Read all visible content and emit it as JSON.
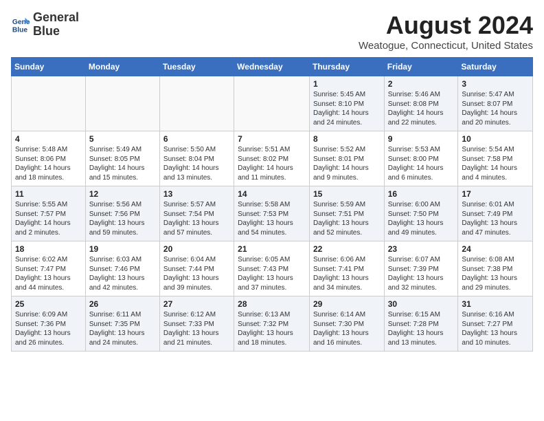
{
  "header": {
    "logo_line1": "General",
    "logo_line2": "Blue",
    "month_year": "August 2024",
    "location": "Weatogue, Connecticut, United States"
  },
  "days_of_week": [
    "Sunday",
    "Monday",
    "Tuesday",
    "Wednesday",
    "Thursday",
    "Friday",
    "Saturday"
  ],
  "weeks": [
    [
      {
        "day": "",
        "sunrise": "",
        "sunset": "",
        "daylight": ""
      },
      {
        "day": "",
        "sunrise": "",
        "sunset": "",
        "daylight": ""
      },
      {
        "day": "",
        "sunrise": "",
        "sunset": "",
        "daylight": ""
      },
      {
        "day": "",
        "sunrise": "",
        "sunset": "",
        "daylight": ""
      },
      {
        "day": "1",
        "sunrise": "Sunrise: 5:45 AM",
        "sunset": "Sunset: 8:10 PM",
        "daylight": "Daylight: 14 hours and 24 minutes."
      },
      {
        "day": "2",
        "sunrise": "Sunrise: 5:46 AM",
        "sunset": "Sunset: 8:08 PM",
        "daylight": "Daylight: 14 hours and 22 minutes."
      },
      {
        "day": "3",
        "sunrise": "Sunrise: 5:47 AM",
        "sunset": "Sunset: 8:07 PM",
        "daylight": "Daylight: 14 hours and 20 minutes."
      }
    ],
    [
      {
        "day": "4",
        "sunrise": "Sunrise: 5:48 AM",
        "sunset": "Sunset: 8:06 PM",
        "daylight": "Daylight: 14 hours and 18 minutes."
      },
      {
        "day": "5",
        "sunrise": "Sunrise: 5:49 AM",
        "sunset": "Sunset: 8:05 PM",
        "daylight": "Daylight: 14 hours and 15 minutes."
      },
      {
        "day": "6",
        "sunrise": "Sunrise: 5:50 AM",
        "sunset": "Sunset: 8:04 PM",
        "daylight": "Daylight: 14 hours and 13 minutes."
      },
      {
        "day": "7",
        "sunrise": "Sunrise: 5:51 AM",
        "sunset": "Sunset: 8:02 PM",
        "daylight": "Daylight: 14 hours and 11 minutes."
      },
      {
        "day": "8",
        "sunrise": "Sunrise: 5:52 AM",
        "sunset": "Sunset: 8:01 PM",
        "daylight": "Daylight: 14 hours and 9 minutes."
      },
      {
        "day": "9",
        "sunrise": "Sunrise: 5:53 AM",
        "sunset": "Sunset: 8:00 PM",
        "daylight": "Daylight: 14 hours and 6 minutes."
      },
      {
        "day": "10",
        "sunrise": "Sunrise: 5:54 AM",
        "sunset": "Sunset: 7:58 PM",
        "daylight": "Daylight: 14 hours and 4 minutes."
      }
    ],
    [
      {
        "day": "11",
        "sunrise": "Sunrise: 5:55 AM",
        "sunset": "Sunset: 7:57 PM",
        "daylight": "Daylight: 14 hours and 2 minutes."
      },
      {
        "day": "12",
        "sunrise": "Sunrise: 5:56 AM",
        "sunset": "Sunset: 7:56 PM",
        "daylight": "Daylight: 13 hours and 59 minutes."
      },
      {
        "day": "13",
        "sunrise": "Sunrise: 5:57 AM",
        "sunset": "Sunset: 7:54 PM",
        "daylight": "Daylight: 13 hours and 57 minutes."
      },
      {
        "day": "14",
        "sunrise": "Sunrise: 5:58 AM",
        "sunset": "Sunset: 7:53 PM",
        "daylight": "Daylight: 13 hours and 54 minutes."
      },
      {
        "day": "15",
        "sunrise": "Sunrise: 5:59 AM",
        "sunset": "Sunset: 7:51 PM",
        "daylight": "Daylight: 13 hours and 52 minutes."
      },
      {
        "day": "16",
        "sunrise": "Sunrise: 6:00 AM",
        "sunset": "Sunset: 7:50 PM",
        "daylight": "Daylight: 13 hours and 49 minutes."
      },
      {
        "day": "17",
        "sunrise": "Sunrise: 6:01 AM",
        "sunset": "Sunset: 7:49 PM",
        "daylight": "Daylight: 13 hours and 47 minutes."
      }
    ],
    [
      {
        "day": "18",
        "sunrise": "Sunrise: 6:02 AM",
        "sunset": "Sunset: 7:47 PM",
        "daylight": "Daylight: 13 hours and 44 minutes."
      },
      {
        "day": "19",
        "sunrise": "Sunrise: 6:03 AM",
        "sunset": "Sunset: 7:46 PM",
        "daylight": "Daylight: 13 hours and 42 minutes."
      },
      {
        "day": "20",
        "sunrise": "Sunrise: 6:04 AM",
        "sunset": "Sunset: 7:44 PM",
        "daylight": "Daylight: 13 hours and 39 minutes."
      },
      {
        "day": "21",
        "sunrise": "Sunrise: 6:05 AM",
        "sunset": "Sunset: 7:43 PM",
        "daylight": "Daylight: 13 hours and 37 minutes."
      },
      {
        "day": "22",
        "sunrise": "Sunrise: 6:06 AM",
        "sunset": "Sunset: 7:41 PM",
        "daylight": "Daylight: 13 hours and 34 minutes."
      },
      {
        "day": "23",
        "sunrise": "Sunrise: 6:07 AM",
        "sunset": "Sunset: 7:39 PM",
        "daylight": "Daylight: 13 hours and 32 minutes."
      },
      {
        "day": "24",
        "sunrise": "Sunrise: 6:08 AM",
        "sunset": "Sunset: 7:38 PM",
        "daylight": "Daylight: 13 hours and 29 minutes."
      }
    ],
    [
      {
        "day": "25",
        "sunrise": "Sunrise: 6:09 AM",
        "sunset": "Sunset: 7:36 PM",
        "daylight": "Daylight: 13 hours and 26 minutes."
      },
      {
        "day": "26",
        "sunrise": "Sunrise: 6:11 AM",
        "sunset": "Sunset: 7:35 PM",
        "daylight": "Daylight: 13 hours and 24 minutes."
      },
      {
        "day": "27",
        "sunrise": "Sunrise: 6:12 AM",
        "sunset": "Sunset: 7:33 PM",
        "daylight": "Daylight: 13 hours and 21 minutes."
      },
      {
        "day": "28",
        "sunrise": "Sunrise: 6:13 AM",
        "sunset": "Sunset: 7:32 PM",
        "daylight": "Daylight: 13 hours and 18 minutes."
      },
      {
        "day": "29",
        "sunrise": "Sunrise: 6:14 AM",
        "sunset": "Sunset: 7:30 PM",
        "daylight": "Daylight: 13 hours and 16 minutes."
      },
      {
        "day": "30",
        "sunrise": "Sunrise: 6:15 AM",
        "sunset": "Sunset: 7:28 PM",
        "daylight": "Daylight: 13 hours and 13 minutes."
      },
      {
        "day": "31",
        "sunrise": "Sunrise: 6:16 AM",
        "sunset": "Sunset: 7:27 PM",
        "daylight": "Daylight: 13 hours and 10 minutes."
      }
    ]
  ]
}
